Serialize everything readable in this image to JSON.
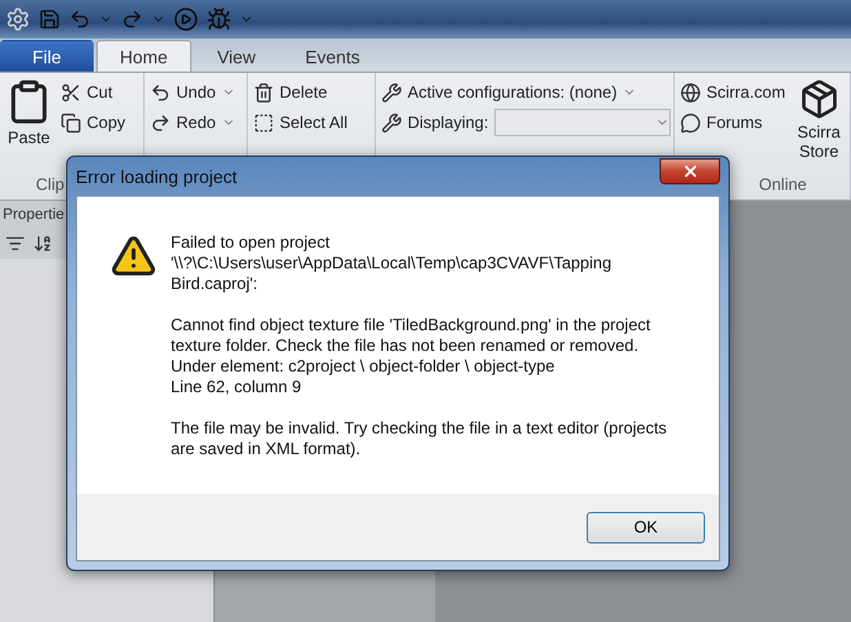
{
  "tabs": [
    {
      "label": "File",
      "kind": "file",
      "selected": false
    },
    {
      "label": "Home",
      "kind": "tab",
      "selected": true
    },
    {
      "label": "View",
      "kind": "tab",
      "selected": false
    },
    {
      "label": "Events",
      "kind": "tab",
      "selected": false
    }
  ],
  "ribbon": {
    "paste": "Paste",
    "cut": "Cut",
    "copy": "Copy",
    "undo": "Undo",
    "redo": "Redo",
    "delete": "Delete",
    "select_all": "Select All",
    "active_configurations": "Active configurations: (none)",
    "displaying": "Displaying:",
    "scirra_com": "Scirra.com",
    "forums": "Forums",
    "scirra_store": "Scirra Store",
    "group_labels": [
      "Clip",
      "Online"
    ]
  },
  "properties": {
    "title": "Propertie"
  },
  "dialog": {
    "title": "Error loading project",
    "paragraphs": [
      [
        "Failed to open project",
        "'\\\\?\\C:\\Users\\user\\AppData\\Local\\Temp\\cap3CVAVF\\Tapping",
        "Bird.caproj':"
      ],
      [
        "Cannot find object texture file 'TiledBackground.png' in the project",
        "texture folder.  Check the file has not been renamed or removed.",
        "Under element: c2project \\ object-folder \\ object-type",
        "Line 62, column 9"
      ],
      [
        "The file may be invalid.  Try checking the file in a text editor (projects",
        "are saved in XML format)."
      ]
    ],
    "button": "OK"
  }
}
